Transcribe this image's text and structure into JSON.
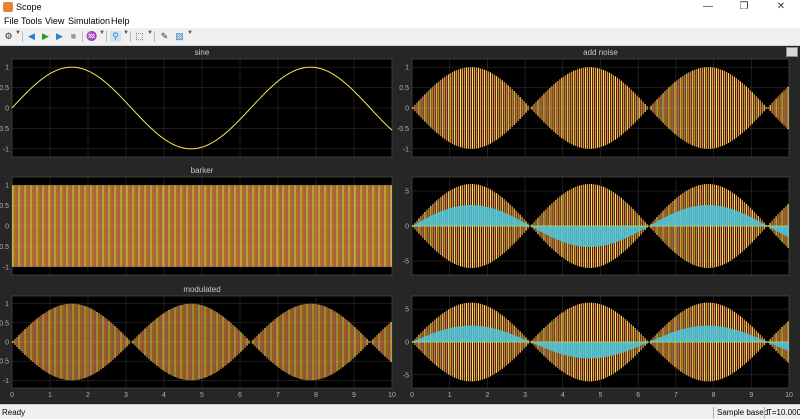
{
  "window": {
    "title": "Scope",
    "minimize": "—",
    "restore": "❐",
    "close": "✕"
  },
  "menu": [
    "File",
    "Tools",
    "View",
    "Simulation",
    "Help"
  ],
  "toolbar": {
    "icons": [
      "settings-icon",
      "step-back-icon",
      "run-icon",
      "step-forward-icon",
      "stop-icon",
      "triggers-icon",
      "zoom-icon",
      "scale-axes-icon",
      "style-icon",
      "highlight-icon"
    ]
  },
  "colors": {
    "background": "#262626",
    "axes": "#000000",
    "grid": "#3a3a3a",
    "tick_text": "#b0b0b0",
    "yellow": "#ffe64d",
    "orange": "#ff9d2e",
    "salmon": "#f08a6c",
    "cyan": "#4cc8e0",
    "green": "#b8e070"
  },
  "status": {
    "left": "Ready",
    "mode": "Sample based",
    "time": "T=10.000"
  },
  "chart_data": [
    {
      "type": "line",
      "title": "sine",
      "xlim": [
        0,
        10
      ],
      "ylim": [
        -1.2,
        1.2
      ],
      "yticks": [
        -1,
        -0.5,
        0,
        0.5,
        1
      ],
      "xticks": [],
      "grid": true,
      "series": [
        {
          "function": "sin(t)",
          "amplitude": 1,
          "color": "#ffe64d"
        }
      ]
    },
    {
      "type": "line",
      "title": "add noise",
      "xlim": [
        0,
        10
      ],
      "ylim": [
        -1.2,
        1.2
      ],
      "yticks": [
        -1,
        -0.5,
        0,
        0.5,
        1
      ],
      "xticks": [],
      "grid": true,
      "series": [
        {
          "function": "dense oscillation inside |sin(t)| envelope",
          "amplitude": 1,
          "color": "#ff9d2e"
        }
      ]
    },
    {
      "type": "line",
      "title": "barker",
      "xlim": [
        0,
        10
      ],
      "ylim": [
        -1.2,
        1.2
      ],
      "yticks": [
        -1,
        -0.5,
        0,
        0.5,
        1
      ],
      "xticks": [],
      "grid": true,
      "series": [
        {
          "function": "dense ±1 code",
          "amplitude": 1,
          "color": "#ffe64d"
        }
      ]
    },
    {
      "type": "line",
      "title": "",
      "xlim": [
        0,
        10
      ],
      "ylim": [
        -7,
        7
      ],
      "yticks": [
        -5,
        0,
        5
      ],
      "xticks": [],
      "grid": true,
      "series": [
        {
          "function": "dense oscillation inside 6·|sin(t)| envelope",
          "amplitude": 6,
          "color": "#ff9d2e"
        },
        {
          "function": "envelope",
          "amplitude": 3,
          "color": "#4cc8e0"
        }
      ]
    },
    {
      "type": "line",
      "title": "modulated",
      "xlim": [
        0,
        10
      ],
      "ylim": [
        -1.2,
        1.2
      ],
      "yticks": [
        -1,
        -0.5,
        0,
        0.5,
        1
      ],
      "xticks": [
        0,
        1,
        2,
        3,
        4,
        5,
        6,
        7,
        8,
        9,
        10
      ],
      "grid": true,
      "series": [
        {
          "function": "dense oscillation inside |sin(t)| envelope",
          "amplitude": 1,
          "color": "#ff9d2e"
        }
      ]
    },
    {
      "type": "line",
      "title": "",
      "xlim": [
        0,
        10
      ],
      "ylim": [
        -7,
        7
      ],
      "yticks": [
        -5,
        0,
        5
      ],
      "xticks": [
        0,
        1,
        2,
        3,
        4,
        5,
        6,
        7,
        8,
        9,
        10
      ],
      "grid": true,
      "series": [
        {
          "function": "dense oscillation inside 6·|sin(t)| envelope",
          "amplitude": 6,
          "color": "#ff9d2e"
        },
        {
          "function": "envelope",
          "amplitude": 2.5,
          "color": "#4cc8e0"
        }
      ]
    }
  ]
}
